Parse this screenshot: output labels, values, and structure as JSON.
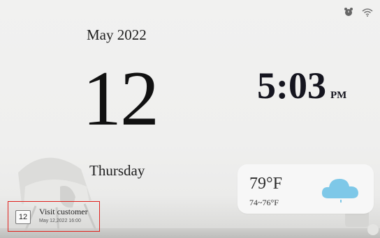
{
  "date": {
    "month_year": "May 2022",
    "day": "12",
    "weekday": "Thursday"
  },
  "clock": {
    "time": "5:03",
    "ampm": "PM"
  },
  "weather": {
    "temp": "79°F",
    "range": "74~76°F",
    "icon": "cloud-icon",
    "cloud_color": "#7ec8e8"
  },
  "event": {
    "day": "12",
    "title": "Visit customer",
    "datetime": "May 12,2022 16:00",
    "highlight_color": "#e0201c"
  },
  "status": {
    "icons": [
      "alarm-icon",
      "wifi-icon"
    ]
  }
}
